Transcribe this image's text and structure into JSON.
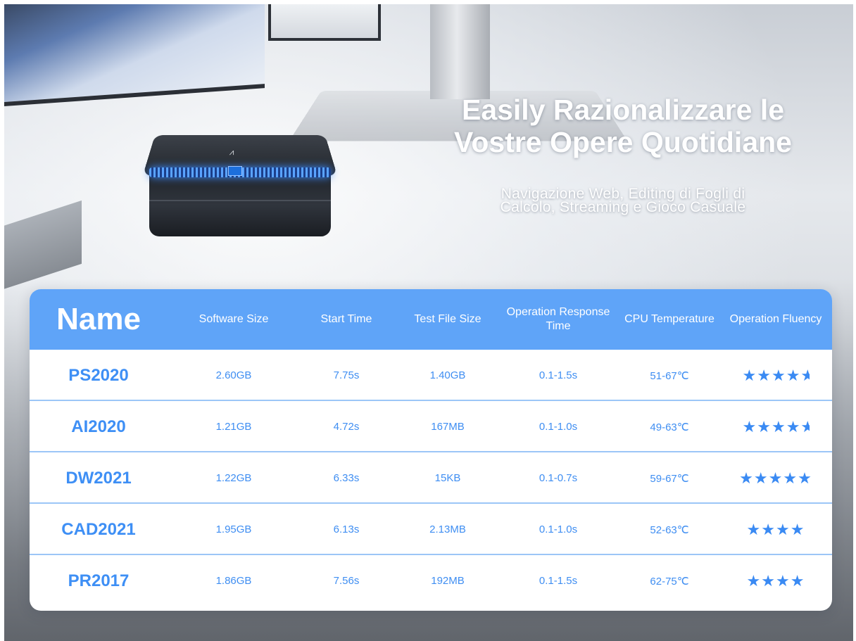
{
  "hero": {
    "headline_line1": "Easily Razionalizzare le",
    "headline_line2": "Vostre Opere Quotidiane",
    "sub_line1": "Navigazione Web, Editing di Fogli di",
    "sub_line2": "Calcolo, Streaming e Gioco Casuale"
  },
  "table": {
    "headers": {
      "name": "Name",
      "software_size": "Software Size",
      "start_time": "Start Time",
      "test_file_size": "Test File Size",
      "response_time": "Operation Response Time",
      "cpu_temp": "CPU Temperature",
      "fluency": "Operation Fluency"
    },
    "rows": [
      {
        "name": "PS2020",
        "software_size": "2.60GB",
        "start_time": "7.75s",
        "test_file_size": "1.40GB",
        "response_time": "0.1-1.5s",
        "cpu_temp": "51-67℃",
        "fluency_stars": 4.5
      },
      {
        "name": "AI2020",
        "software_size": "1.21GB",
        "start_time": "4.72s",
        "test_file_size": "167MB",
        "response_time": "0.1-1.0s",
        "cpu_temp": "49-63℃",
        "fluency_stars": 4.5
      },
      {
        "name": "DW2021",
        "software_size": "1.22GB",
        "start_time": "6.33s",
        "test_file_size": "15KB",
        "response_time": "0.1-0.7s",
        "cpu_temp": "59-67℃",
        "fluency_stars": 5
      },
      {
        "name": "CAD2021",
        "software_size": "1.95GB",
        "start_time": "6.13s",
        "test_file_size": "2.13MB",
        "response_time": "0.1-1.0s",
        "cpu_temp": "52-63℃",
        "fluency_stars": 4
      },
      {
        "name": "PR2017",
        "software_size": "1.86GB",
        "start_time": "7.56s",
        "test_file_size": "192MB",
        "response_time": "0.1-1.5s",
        "cpu_temp": "62-75℃",
        "fluency_stars": 4
      }
    ]
  },
  "colors": {
    "header_bg": "#5fa4f8",
    "accent_text": "#3f8ef2",
    "star": "#3a8af3"
  }
}
